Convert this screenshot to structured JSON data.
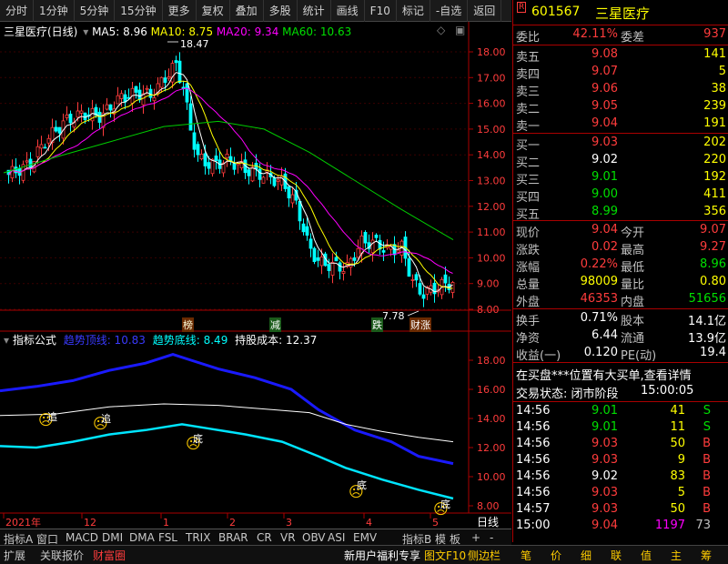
{
  "toolbar": {
    "items": [
      "分时",
      "1分钟",
      "5分钟",
      "15分钟",
      "更多",
      "复权",
      "叠加",
      "多股",
      "统计",
      "画线",
      "F10",
      "标记",
      "-自选",
      "返回"
    ]
  },
  "chart_header": {
    "stock_title": "三星医疗(日线)",
    "ma5": "MA5: 8.96",
    "ma10": "MA10: 8.75",
    "ma20": "MA20: 9.34",
    "ma60": "MA60: 10.63"
  },
  "price_axis": [
    "18.00",
    "17.00",
    "16.00",
    "15.00",
    "14.00",
    "13.00",
    "12.00",
    "11.00",
    "10.00",
    "9.00",
    "8.00"
  ],
  "price_annotations": {
    "high": "18.47",
    "low": "7.78"
  },
  "signal_labels": [
    "榜",
    "减",
    "跌",
    "财涨"
  ],
  "indicator_header": {
    "name": "指标公式",
    "top_line": "趋势顶线: 10.83",
    "bottom_line": "趋势底线: 8.49",
    "cost": "持股成本: 12.37"
  },
  "indicator_axis": [
    "18.00",
    "16.00",
    "14.00",
    "12.00",
    "10.00",
    "8.00"
  ],
  "indicator_marks": [
    "追",
    "追",
    "底",
    "底",
    "底"
  ],
  "time_axis": {
    "labels": [
      "2021年",
      "12",
      "1",
      "2",
      "3",
      "4",
      "5"
    ],
    "period": "日线"
  },
  "indicator_tabs": [
    "指标A",
    "窗口",
    "MACD",
    "DMI",
    "DMA",
    "FSL",
    "TRIX",
    "BRAR",
    "CR",
    "VR",
    "OBV",
    "ASI",
    "EMV",
    "指标B",
    "模",
    "板",
    "+",
    "-"
  ],
  "bottom_bar": {
    "left": [
      "扩展",
      "关联报价",
      "财富圈"
    ],
    "news": "新用户福利专享",
    "right_btns": [
      "图文F10",
      "侧边栏"
    ],
    "tools": [
      "笔",
      "价",
      "细",
      "联",
      "值",
      "主",
      "筹"
    ]
  },
  "quote_panel": {
    "code": "601567",
    "name": "三星医疗",
    "r_badge": "R",
    "weibi_label": "委比",
    "weibi": "42.11%",
    "weicha_label": "委差",
    "weicha": "937",
    "asks": [
      {
        "label": "卖五",
        "price": "9.08",
        "vol": "141"
      },
      {
        "label": "卖四",
        "price": "9.07",
        "vol": "5"
      },
      {
        "label": "卖三",
        "price": "9.06",
        "vol": "38"
      },
      {
        "label": "卖二",
        "price": "9.05",
        "vol": "239"
      },
      {
        "label": "卖一",
        "price": "9.04",
        "vol": "191"
      }
    ],
    "bids": [
      {
        "label": "买一",
        "price": "9.03",
        "vol": "202"
      },
      {
        "label": "买二",
        "price": "9.02",
        "vol": "220"
      },
      {
        "label": "买三",
        "price": "9.01",
        "vol": "192"
      },
      {
        "label": "买四",
        "price": "9.00",
        "vol": "411"
      },
      {
        "label": "买五",
        "price": "8.99",
        "vol": "356"
      }
    ],
    "stats": [
      {
        "l1": "现价",
        "v1": "9.04",
        "l2": "今开",
        "v2": "9.07"
      },
      {
        "l1": "涨跌",
        "v1": "0.02",
        "l2": "最高",
        "v2": "9.27"
      },
      {
        "l1": "涨幅",
        "v1": "0.22%",
        "l2": "最低",
        "v2": "8.96"
      },
      {
        "l1": "总量",
        "v1": "98009",
        "l2": "量比",
        "v2": "0.80"
      },
      {
        "l1": "外盘",
        "v1": "46353",
        "l2": "内盘",
        "v2": "51656"
      }
    ],
    "fin": [
      {
        "l1": "换手",
        "v1": "0.71%",
        "l2": "股本",
        "v2": "14.1亿"
      },
      {
        "l1": "净资",
        "v1": "6.44",
        "l2": "流通",
        "v2": "13.9亿"
      },
      {
        "l1": "收益(一)",
        "v1": "0.120",
        "l2": "PE(动)",
        "v2": "19.4"
      }
    ],
    "notice": "在买盘***位置有大买单,查看详情",
    "status": "交易状态: 闭市阶段",
    "status_time": "15:00:05",
    "ticks": [
      {
        "time": "14:56",
        "price": "9.01",
        "vol": "41",
        "side": "S"
      },
      {
        "time": "14:56",
        "price": "9.01",
        "vol": "11",
        "side": "S"
      },
      {
        "time": "14:56",
        "price": "9.03",
        "vol": "50",
        "side": "B"
      },
      {
        "time": "14:56",
        "price": "9.03",
        "vol": "9",
        "side": "B"
      },
      {
        "time": "14:56",
        "price": "9.02",
        "vol": "83",
        "side": "B"
      },
      {
        "time": "14:56",
        "price": "9.03",
        "vol": "5",
        "side": "B"
      },
      {
        "time": "14:57",
        "price": "9.03",
        "vol": "50",
        "side": "B"
      },
      {
        "time": "15:00",
        "price": "9.04",
        "vol": "1197",
        "side": "73"
      }
    ]
  },
  "colors": {
    "up": "#ff3c3c",
    "down": "#00ffff",
    "ma5": "#ffffff",
    "ma10": "#ffff00",
    "ma20": "#ff00ff",
    "ma60": "#00cc00",
    "trend_top": "#1a1aff",
    "trend_bottom": "#00e5ff"
  }
}
